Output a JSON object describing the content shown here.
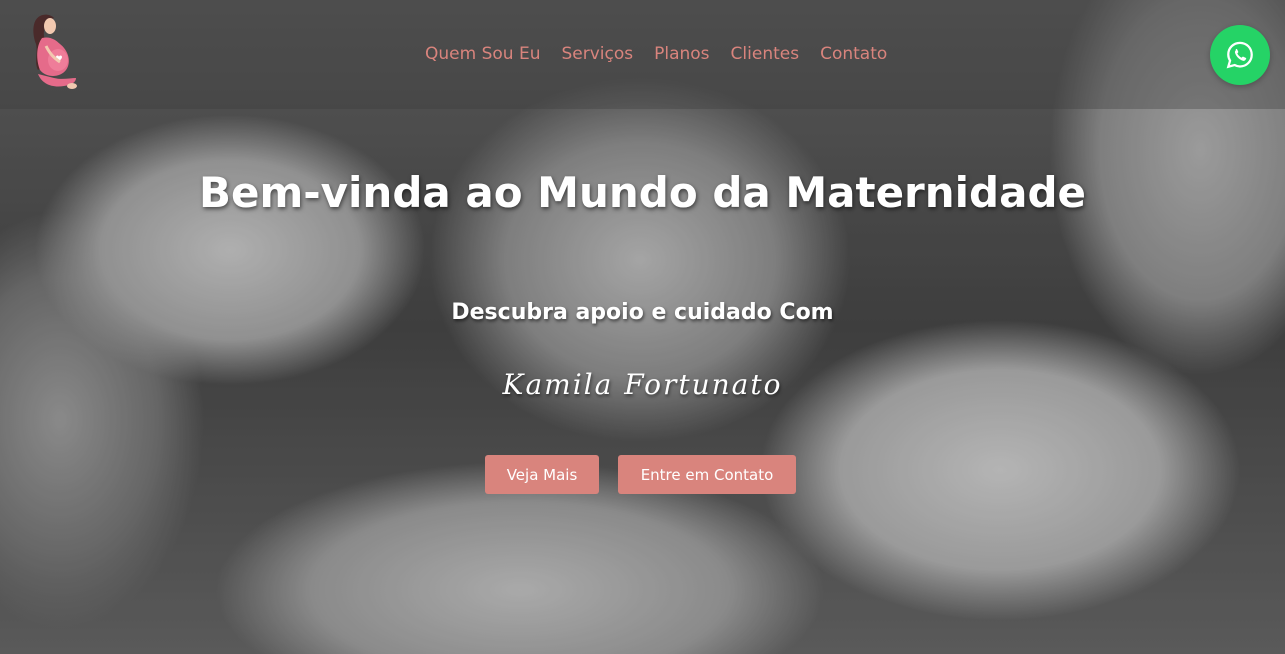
{
  "nav": {
    "items": [
      {
        "label": "Quem Sou Eu"
      },
      {
        "label": "Serviços"
      },
      {
        "label": "Planos"
      },
      {
        "label": "Clientes"
      },
      {
        "label": "Contato"
      }
    ]
  },
  "hero": {
    "title": "Bem-vinda ao Mundo da Maternidade",
    "subtitle": "Descubra apoio e cuidado Com",
    "signature": "Kamila Fortunato",
    "buttons": {
      "more": "Veja Mais",
      "contact": "Entre em Contato"
    }
  },
  "icons": {
    "logo": "pregnant-woman-logo",
    "whatsapp": "whatsapp-icon"
  },
  "colors": {
    "accent": "#d9847d",
    "whatsapp": "#25d366",
    "text": "#ffffff"
  }
}
